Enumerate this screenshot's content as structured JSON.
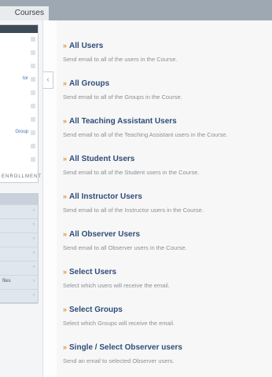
{
  "header": {
    "tab_label": "Courses"
  },
  "left_panel": {
    "rows": [
      {
        "label": ""
      },
      {
        "label": ""
      },
      {
        "label": ""
      },
      {
        "label": "tor"
      },
      {
        "label": ""
      },
      {
        "label": ""
      },
      {
        "label": ""
      },
      {
        "label": "Group"
      },
      {
        "label": ""
      },
      {
        "label": ""
      }
    ],
    "section_label": "ENROLLMENT",
    "menu_rows": [
      {
        "label": ""
      },
      {
        "label": ""
      },
      {
        "label": ""
      },
      {
        "label": ""
      },
      {
        "label": ""
      },
      {
        "label": "files"
      },
      {
        "label": ""
      }
    ]
  },
  "collapse_glyph": "‹",
  "email_options": [
    {
      "title": "All Users",
      "description": "Send email to all of the users in the Course."
    },
    {
      "title": "All Groups",
      "description": "Send email to all of the Groups in the Course."
    },
    {
      "title": "All Teaching Assistant Users",
      "description": "Send email to all of the Teaching Assistant users in the Course."
    },
    {
      "title": "All Student Users",
      "description": "Send email to all of the Student users in the Course."
    },
    {
      "title": "All Instructor Users",
      "description": "Send email to all of the Instructor users in the Course."
    },
    {
      "title": "All Observer Users",
      "description": "Send email to all Observer users in the Course."
    },
    {
      "title": "Select Users",
      "description": "Select which users will receive the email."
    },
    {
      "title": "Select Groups",
      "description": "Select which Groups will receive the email."
    },
    {
      "title": "Single / Select Observer users",
      "description": "Send an email to selected Observer users."
    }
  ],
  "colors": {
    "link": "#2f4c78",
    "bullet": "#f08a24",
    "description": "#8a9096"
  }
}
